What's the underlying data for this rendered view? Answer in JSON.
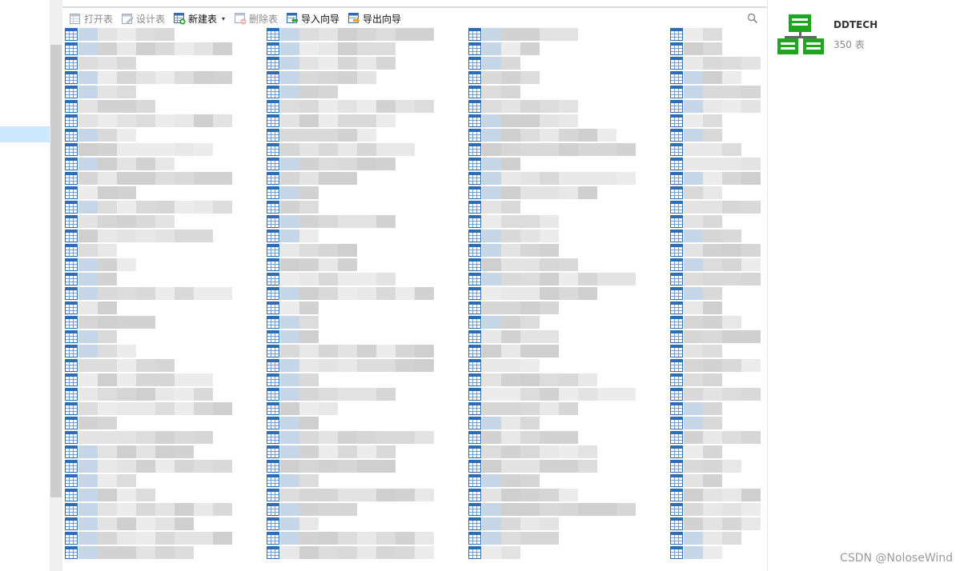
{
  "toolbar": {
    "open_table": "打开表",
    "design_table": "设计表",
    "new_table": "新建表",
    "delete_table": "删除表",
    "import_wizard": "导入向导",
    "export_wizard": "导出向导",
    "new_table_dropdown": "▾",
    "search_icon": "magnifier"
  },
  "icons": {
    "table_item": "table-grid-icon",
    "database": "database-tree-icon"
  },
  "colors": {
    "accent_blue": "#2c6db5",
    "selection": "#cce8ff",
    "db_green": "#1fa51f"
  },
  "info_panel": {
    "database_name": "DDTECH",
    "table_count": "350 表"
  },
  "watermark": "CSDN @NoloseWind"
}
